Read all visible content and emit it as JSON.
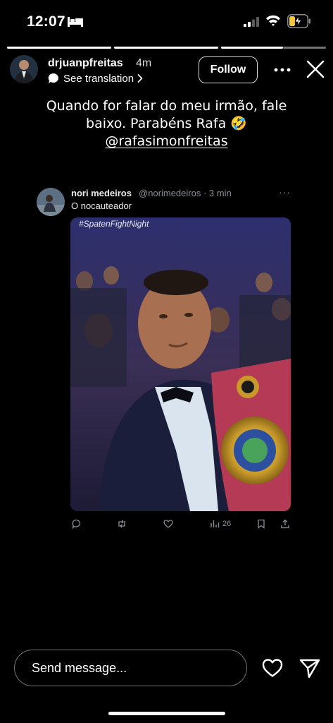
{
  "status_bar": {
    "time": "12:07",
    "icons": [
      "bed-icon",
      "signal-icon",
      "wifi-icon",
      "battery-charging-icon"
    ]
  },
  "story": {
    "progress_segments": [
      {
        "progress": 1.0
      },
      {
        "progress": 1.0
      },
      {
        "progress": 1.0
      },
      {
        "progress": 0.55
      }
    ],
    "username": "drjuanpfreitas",
    "time_ago": "4m",
    "translation_label": "See translation",
    "follow_label": "Follow",
    "caption_line1": "Quando for falar do meu irmão, fale",
    "caption_line2": "baixo. Parabéns Rafa 🤣",
    "caption_mention": "@rafasimonfreitas"
  },
  "tweet": {
    "name": "nori medeiros",
    "handle_time": "@norimedeiros · 3 min",
    "more": "···",
    "text": "O nocauteador",
    "media_hashtag": "#SpatenFightNight",
    "actions": {
      "reply": "",
      "retweet": "",
      "like": "",
      "views": "26",
      "bookmark": "",
      "share": ""
    }
  },
  "composer": {
    "placeholder": "Send message..."
  },
  "colors": {
    "background": "#000000",
    "text": "#ffffff",
    "muted": "#8b9096"
  }
}
